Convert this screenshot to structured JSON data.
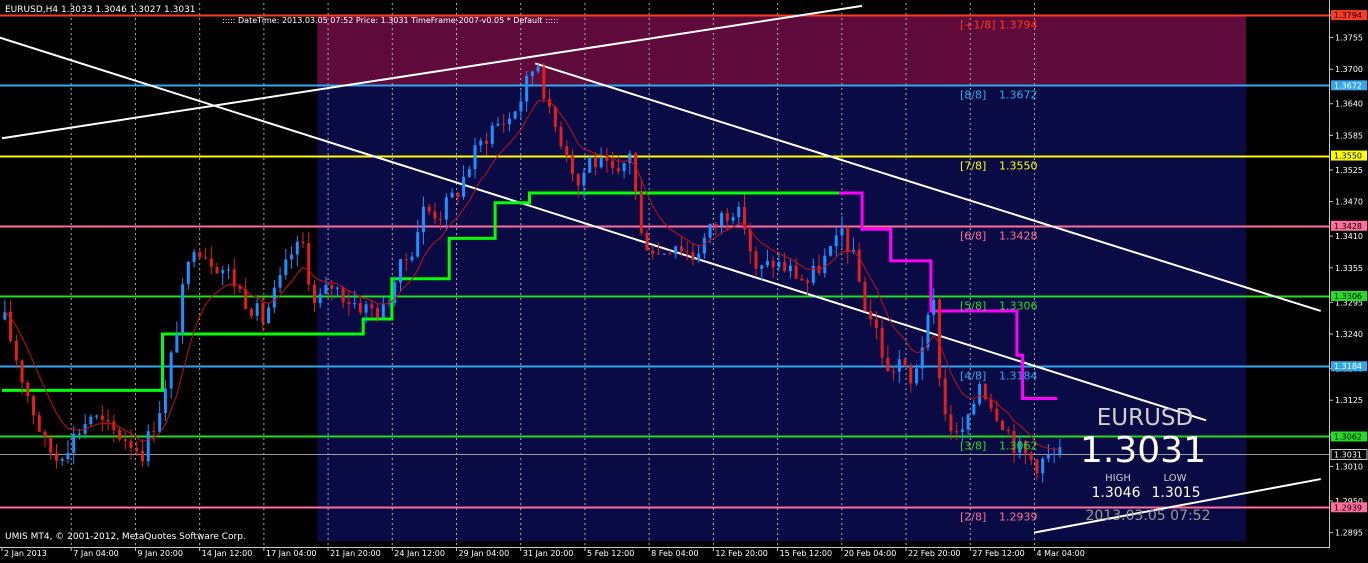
{
  "header": {
    "symbol_info": "EURUSD,H4  1.3033 1.3046 1.3027 1.3031",
    "info_line": ":::::  DateTime: 2013.03.05 07:52    Price: 1.3031    TimeFrame-2007-v0.05    *  Default  :::::"
  },
  "footer": {
    "copyright": "UMIS MT4, © 2001-2012, MetaQuotes Software Corp."
  },
  "panel": {
    "symbol": "EURUSD",
    "price": "1.3031",
    "high_label": "HIGH",
    "low_label": "LOW",
    "high": "1.3046",
    "low": "1.3015",
    "datetime": "2013.03.05 07:52"
  },
  "colors": {
    "background": "#000000",
    "grid": "#c8c8c8",
    "candle_blue": "#1e90ff",
    "candle_red": "#e0201e",
    "zone_top": "#5e0a3a",
    "zone_mid": "#0a0a44",
    "channel": "#ffffff",
    "step_green": "#00ff00",
    "step_magenta": "#ff00ff"
  },
  "chart_data": {
    "type": "candlestick",
    "symbol": "EURUSD",
    "timeframe": "H4",
    "y_ticks": [
      "1.3794",
      "1.3755",
      "1.3700",
      "1.3640",
      "1.3585",
      "1.3525",
      "1.3470",
      "1.3410",
      "1.3355",
      "1.3295",
      "1.3240",
      "1.3180",
      "1.3125",
      "1.3065",
      "1.3010",
      "1.2950",
      "1.2895"
    ],
    "x_ticks": [
      "2 Jan 2013",
      "7 Jan 04:00",
      "9 Jan 20:00",
      "14 Jan 12:00",
      "17 Jan 04:00",
      "21 Jan 20:00",
      "24 Jan 12:00",
      "29 Jan 04:00",
      "31 Jan 20:00",
      "5 Feb 12:00",
      "8 Feb 04:00",
      "12 Feb 20:00",
      "15 Feb 12:00",
      "20 Feb 04:00",
      "22 Feb 20:00",
      "27 Feb 12:00",
      "4 Mar 04:00"
    ],
    "ylim": [
      1.287,
      1.3815
    ],
    "murrey_levels": [
      {
        "label": "[+1/8]",
        "value": "1.3794",
        "price": 1.3794,
        "color": "#ff3b1f",
        "tag_color": "#ff3b1f",
        "tag_text_color": "#000000"
      },
      {
        "label": "[8/8]",
        "value": "1.3672",
        "price": 1.3672,
        "color": "#33a6ee",
        "tag_color": "#33a6ee",
        "tag_text_color": "#ffffff"
      },
      {
        "label": "[7/8]",
        "value": "1.3550",
        "price": 1.355,
        "color": "#ffff00",
        "tag_color": "#ffff00",
        "tag_text_color": "#000000"
      },
      {
        "label": "[6/8]",
        "value": "1.3428",
        "price": 1.3428,
        "color": "#ff6e9c",
        "tag_color": "#ff6e9c",
        "tag_text_color": "#000000"
      },
      {
        "label": "[5/8]",
        "value": "1.3306",
        "price": 1.3306,
        "color": "#22dd22",
        "tag_color": "#22dd22",
        "tag_text_color": "#000000"
      },
      {
        "label": "[4/8]",
        "value": "1.3184",
        "price": 1.3184,
        "color": "#33a6ee",
        "tag_color": "#33a6ee",
        "tag_text_color": "#ffffff"
      },
      {
        "label": "[3/8]",
        "value": "1.3062",
        "price": 1.3062,
        "color": "#22dd22",
        "tag_color": "#22dd22",
        "tag_text_color": "#000000"
      },
      {
        "label": "[2/8]",
        "value": "1.2939",
        "price": 1.2939,
        "color": "#ff6e9c",
        "tag_color": "#ff6e9c",
        "tag_text_color": "#000000"
      }
    ],
    "current_price": {
      "value": "1.3031",
      "price": 1.3031
    },
    "step_line_green": [
      [
        0,
        1.3142
      ],
      [
        28,
        1.3142
      ],
      [
        28,
        1.324
      ],
      [
        63,
        1.324
      ],
      [
        63,
        1.3266
      ],
      [
        68,
        1.3266
      ],
      [
        68,
        1.3336
      ],
      [
        78,
        1.3336
      ],
      [
        78,
        1.3406
      ],
      [
        86,
        1.3406
      ],
      [
        86,
        1.3468
      ],
      [
        92,
        1.3468
      ],
      [
        92,
        1.3485
      ],
      [
        146,
        1.3485
      ]
    ],
    "step_line_magenta": [
      [
        146,
        1.3485
      ],
      [
        150,
        1.3485
      ],
      [
        150,
        1.3422
      ],
      [
        155,
        1.3422
      ],
      [
        155,
        1.3367
      ],
      [
        162,
        1.3367
      ],
      [
        162,
        1.328
      ],
      [
        177,
        1.328
      ],
      [
        177,
        1.3203
      ],
      [
        178,
        1.3203
      ],
      [
        178,
        1.3128
      ],
      [
        184,
        1.3128
      ]
    ],
    "channel_lines": [
      {
        "from": [
          -40,
          1.388
        ],
        "to": [
          210,
          1.309
        ]
      },
      {
        "from": [
          93,
          1.371
        ],
        "to": [
          230,
          1.328
        ]
      },
      {
        "from": [
          0,
          1.358
        ],
        "to": [
          150,
          1.381
        ]
      },
      {
        "from": [
          180,
          1.2895
        ],
        "to": [
          230,
          1.2988
        ]
      }
    ],
    "candles_bars": 184,
    "candle_anchors": [
      [
        0,
        1.3265
      ],
      [
        3,
        1.3165
      ],
      [
        7,
        1.3048
      ],
      [
        9,
        1.3025
      ],
      [
        12,
        1.3062
      ],
      [
        15,
        1.31
      ],
      [
        18,
        1.3075
      ],
      [
        21,
        1.306
      ],
      [
        24,
        1.3035
      ],
      [
        26,
        1.3085
      ],
      [
        28,
        1.314
      ],
      [
        31,
        1.331
      ],
      [
        33,
        1.34
      ],
      [
        36,
        1.337
      ],
      [
        39,
        1.3345
      ],
      [
        42,
        1.33
      ],
      [
        45,
        1.3265
      ],
      [
        48,
        1.333
      ],
      [
        50,
        1.338
      ],
      [
        52,
        1.3395
      ],
      [
        54,
        1.329
      ],
      [
        57,
        1.3325
      ],
      [
        60,
        1.33
      ],
      [
        63,
        1.3285
      ],
      [
        66,
        1.328
      ],
      [
        68,
        1.3335
      ],
      [
        71,
        1.339
      ],
      [
        73,
        1.3455
      ],
      [
        76,
        1.345
      ],
      [
        79,
        1.349
      ],
      [
        82,
        1.3555
      ],
      [
        85,
        1.36
      ],
      [
        88,
        1.3615
      ],
      [
        90,
        1.365
      ],
      [
        92,
        1.37
      ],
      [
        93,
        1.3712
      ],
      [
        95,
        1.362
      ],
      [
        98,
        1.356
      ],
      [
        100,
        1.35
      ],
      [
        102,
        1.3545
      ],
      [
        105,
        1.3525
      ],
      [
        107,
        1.351
      ],
      [
        109,
        1.356
      ],
      [
        111,
        1.341
      ],
      [
        114,
        1.338
      ],
      [
        117,
        1.34
      ],
      [
        120,
        1.3375
      ],
      [
        123,
        1.342
      ],
      [
        125,
        1.3445
      ],
      [
        127,
        1.346
      ],
      [
        129,
        1.343
      ],
      [
        131,
        1.3345
      ],
      [
        134,
        1.3365
      ],
      [
        137,
        1.335
      ],
      [
        140,
        1.333
      ],
      [
        143,
        1.337
      ],
      [
        145,
        1.3395
      ],
      [
        146,
        1.342
      ],
      [
        148,
        1.337
      ],
      [
        150,
        1.329
      ],
      [
        152,
        1.3245
      ],
      [
        154,
        1.317
      ],
      [
        156,
        1.3195
      ],
      [
        158,
        1.315
      ],
      [
        160,
        1.3225
      ],
      [
        162,
        1.329
      ],
      [
        163,
        1.3175
      ],
      [
        164,
        1.31
      ],
      [
        166,
        1.306
      ],
      [
        168,
        1.3085
      ],
      [
        170,
        1.316
      ],
      [
        172,
        1.312
      ],
      [
        174,
        1.309
      ],
      [
        176,
        1.305
      ],
      [
        178,
        1.303
      ],
      [
        180,
        1.3015
      ],
      [
        182,
        1.3025
      ],
      [
        184,
        1.3031
      ]
    ]
  }
}
